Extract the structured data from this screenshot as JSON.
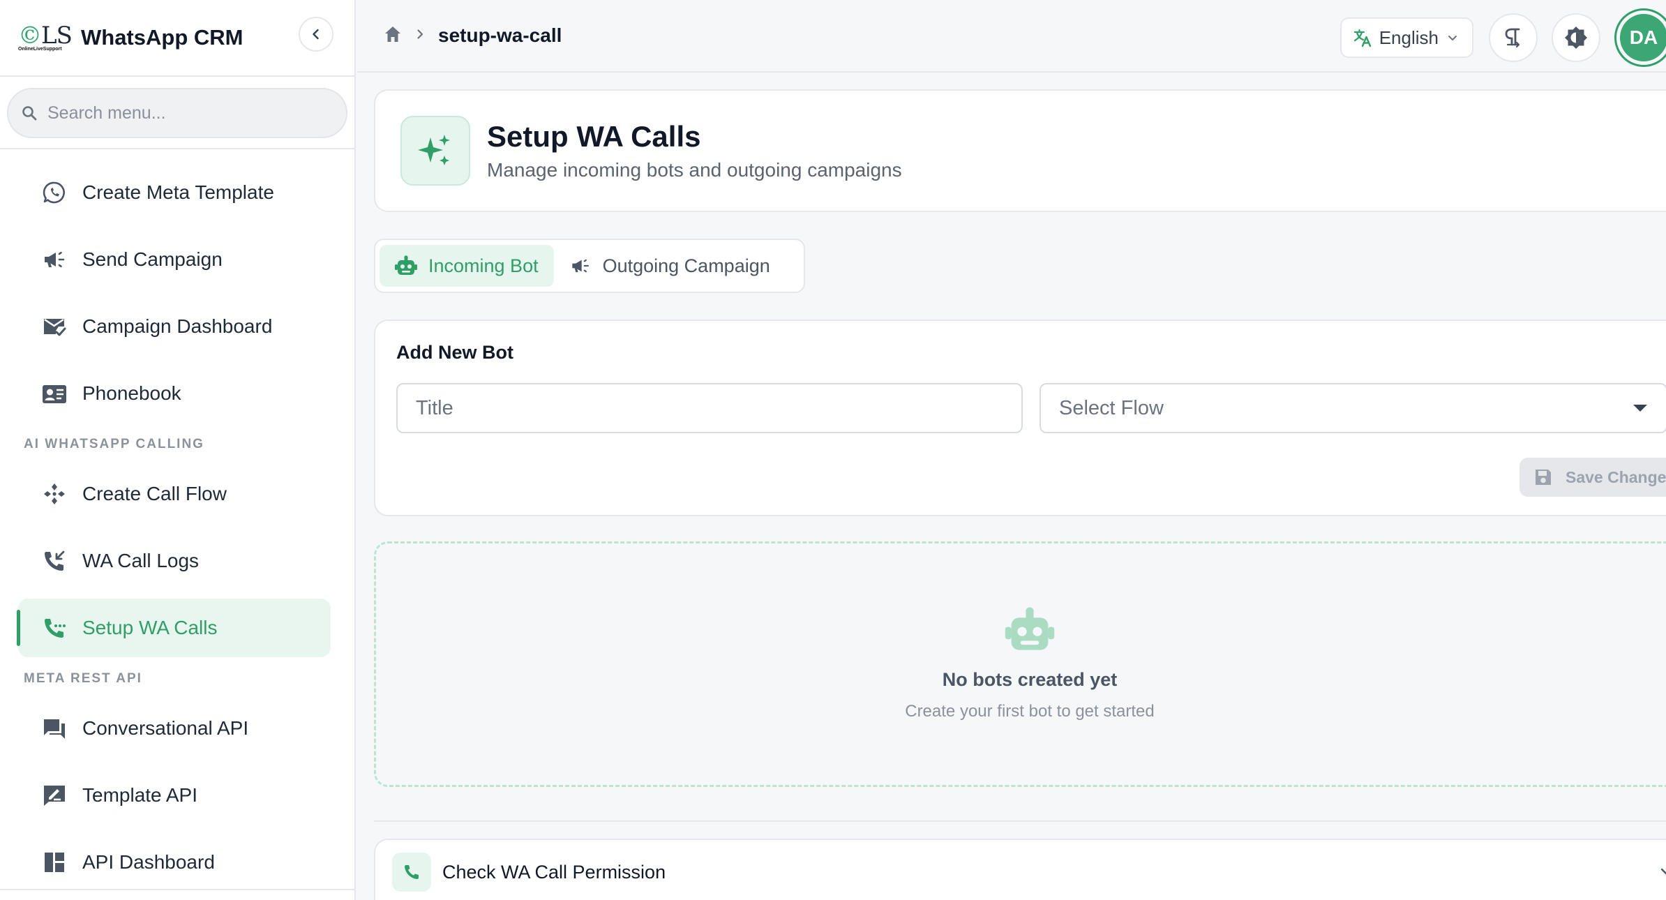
{
  "brand": {
    "logo_text": "OLS",
    "logo_sub": "OnlineLiveSupport",
    "name": "WhatsApp CRM"
  },
  "search": {
    "placeholder": "Search menu..."
  },
  "sidebar": {
    "items_top": [
      {
        "label": "Create Meta Template",
        "icon": "whatsapp-icon"
      },
      {
        "label": "Send Campaign",
        "icon": "megaphone-icon"
      },
      {
        "label": "Campaign Dashboard",
        "icon": "mail-check-icon"
      },
      {
        "label": "Phonebook",
        "icon": "contact-card-icon"
      }
    ],
    "section_calling": "AI WHATSAPP CALLING",
    "items_calling": [
      {
        "label": "Create Call Flow",
        "icon": "flow-diamond-icon"
      },
      {
        "label": "WA Call Logs",
        "icon": "phone-incoming-icon"
      },
      {
        "label": "Setup WA Calls",
        "icon": "phone-dots-icon",
        "active": true
      }
    ],
    "section_api": "META REST API",
    "items_api": [
      {
        "label": "Conversational API",
        "icon": "chat-bubbles-icon"
      },
      {
        "label": "Template API",
        "icon": "edit-box-icon"
      },
      {
        "label": "API Dashboard",
        "icon": "dashboard-icon"
      }
    ]
  },
  "topbar": {
    "breadcrumb_current": "setup-wa-call",
    "language": "English",
    "avatar_initials": "DA"
  },
  "header": {
    "title": "Setup WA Calls",
    "subtitle": "Manage incoming bots and outgoing campaigns"
  },
  "tabs": [
    {
      "label": "Incoming Bot",
      "active": true
    },
    {
      "label": "Outgoing Campaign",
      "active": false
    }
  ],
  "bot_form": {
    "title": "Add New Bot",
    "title_placeholder": "Title",
    "flow_placeholder": "Select Flow",
    "save_label": "Save Changes"
  },
  "empty_state": {
    "title": "No bots created yet",
    "subtitle": "Create your first bot to get started"
  },
  "permission": {
    "label": "Check WA Call Permission"
  },
  "colors": {
    "accent": "#2f9e67",
    "accent_light": "#e6f5ee",
    "border": "#e5e7eb",
    "text": "#1f2937"
  }
}
